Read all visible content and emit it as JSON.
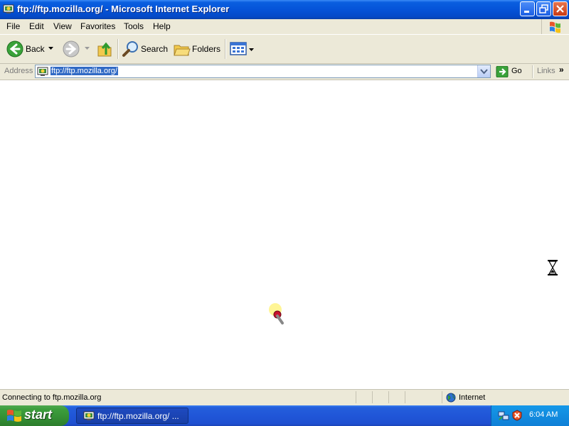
{
  "window": {
    "title": "ftp://ftp.mozilla.org/ - Microsoft Internet Explorer",
    "buttons": [
      "minimize-icon",
      "restore-icon",
      "close-icon"
    ]
  },
  "menu": {
    "items": [
      "File",
      "Edit",
      "View",
      "Favorites",
      "Tools",
      "Help"
    ]
  },
  "toolbar": {
    "back_label": "Back",
    "search_label": "Search",
    "folders_label": "Folders"
  },
  "address_bar": {
    "label": "Address",
    "value": "ftp://ftp.mozilla.org/",
    "go_label": "Go",
    "links_label": "Links"
  },
  "status_bar": {
    "text": "Connecting to ftp.mozilla.org",
    "zone": "Internet"
  },
  "taskbar": {
    "start_label": "start",
    "task_label": "ftp://ftp.mozilla.org/ ...",
    "clock": "6:04 AM"
  },
  "colors": {
    "titlebar": "#0553d8",
    "chrome": "#ece9d8",
    "selection": "#316ac5",
    "taskbar": "#245edb",
    "start_button": "#3c9e3c",
    "tray": "#0f7fd6"
  }
}
